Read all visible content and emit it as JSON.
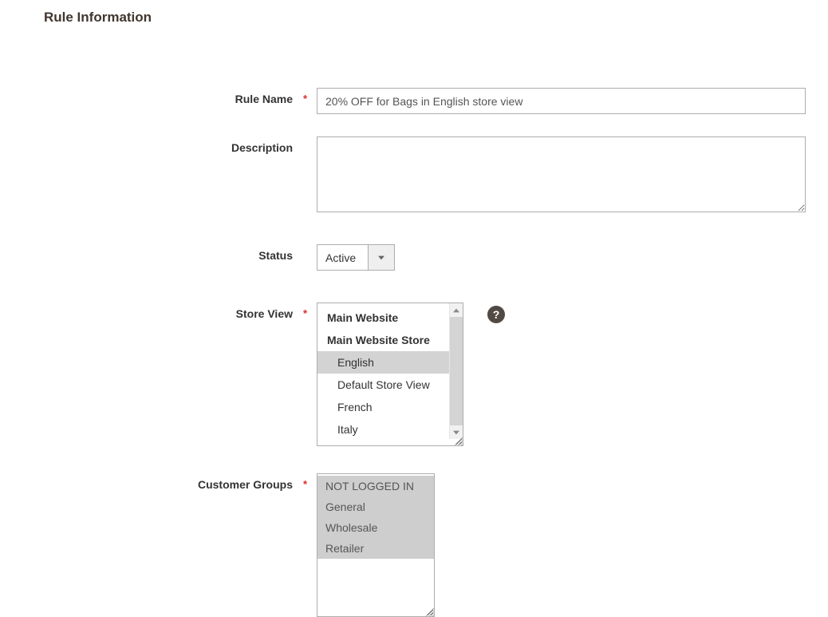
{
  "section_title": "Rule Information",
  "fields": {
    "rule_name": {
      "label": "Rule Name",
      "value": "20% OFF for Bags in English store view",
      "required": true
    },
    "description": {
      "label": "Description",
      "value": "",
      "required": false
    },
    "status": {
      "label": "Status",
      "value": "Active",
      "required": false
    },
    "store_view": {
      "label": "Store View",
      "required": true,
      "options": [
        {
          "label": "Main Website",
          "bold": true,
          "indent": 0,
          "selected": false
        },
        {
          "label": "Main Website Store",
          "bold": true,
          "indent": 0,
          "selected": false
        },
        {
          "label": "English",
          "bold": false,
          "indent": 1,
          "selected": true
        },
        {
          "label": "Default Store View",
          "bold": false,
          "indent": 1,
          "selected": false
        },
        {
          "label": "French",
          "bold": false,
          "indent": 1,
          "selected": false
        },
        {
          "label": "Italy",
          "bold": false,
          "indent": 1,
          "selected": false
        }
      ]
    },
    "customer_groups": {
      "label": "Customer Groups",
      "required": true,
      "options": [
        {
          "label": "NOT LOGGED IN",
          "selected": true
        },
        {
          "label": "General",
          "selected": true
        },
        {
          "label": "Wholesale",
          "selected": true
        },
        {
          "label": "Retailer",
          "selected": true
        }
      ]
    }
  },
  "help_tooltip": "?"
}
